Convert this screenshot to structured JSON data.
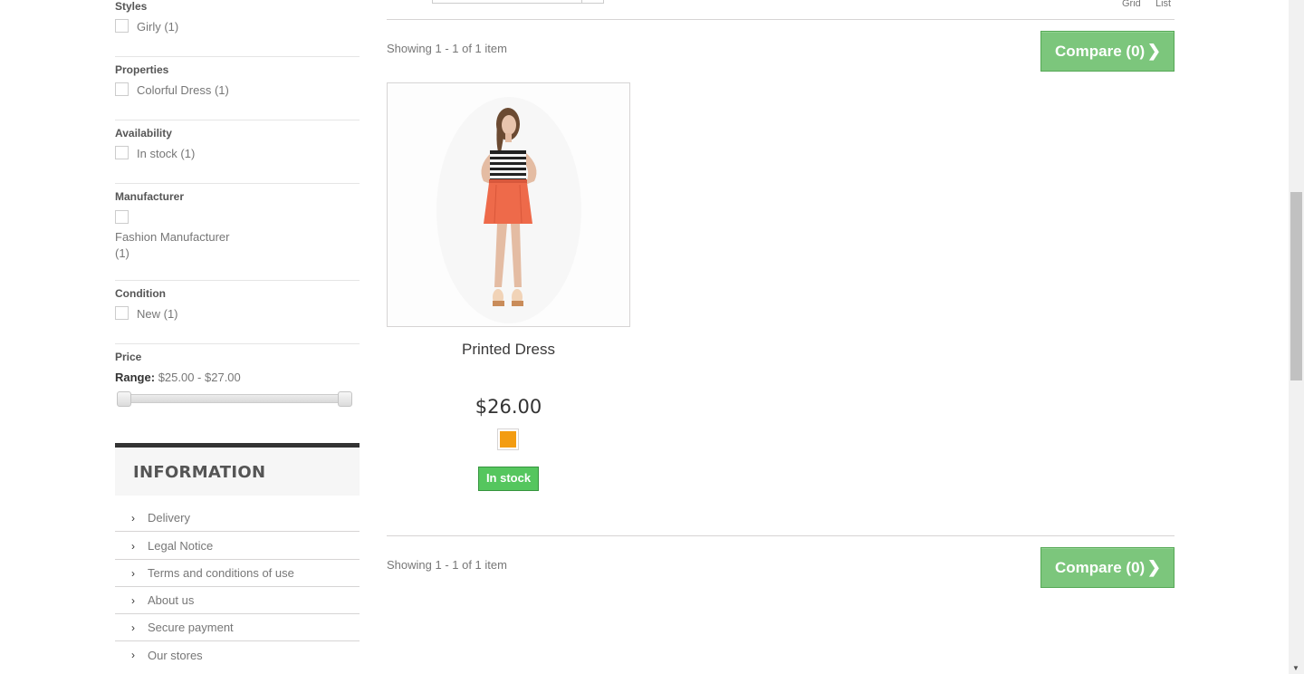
{
  "filters": {
    "styles": {
      "title": "Styles",
      "options": [
        "Girly (1)"
      ]
    },
    "properties": {
      "title": "Properties",
      "options": [
        "Colorful Dress (1)"
      ]
    },
    "availability": {
      "title": "Availability",
      "options": [
        "In stock (1)"
      ]
    },
    "manufacturer": {
      "title": "Manufacturer",
      "options": [
        "Fashion Manufacturer (1)"
      ]
    },
    "condition": {
      "title": "Condition",
      "options": [
        "New (1)"
      ]
    },
    "price": {
      "title": "Price",
      "range_label": "Range:",
      "range_value": "$25.00 - $27.00"
    }
  },
  "information": {
    "title": "INFORMATION",
    "items": [
      {
        "label": "Delivery"
      },
      {
        "label": "Legal Notice"
      },
      {
        "label": "Terms and conditions of use"
      },
      {
        "label": "About us"
      },
      {
        "label": "Secure payment"
      },
      {
        "label": "Our stores"
      }
    ]
  },
  "toolbar": {
    "view_grid": "Grid",
    "view_list": "List",
    "showing_top": "Showing 1 - 1 of 1 item",
    "showing_bottom": "Showing 1 - 1 of 1 item",
    "compare_label": "Compare (0)"
  },
  "product": {
    "name": "Printed Dress",
    "price": "$26.00",
    "availability": "In stock",
    "color_swatch": "#f39c11"
  },
  "colors": {
    "compare_bg": "#7cc67c",
    "stock_bg": "#55c65e",
    "info_border": "#333333"
  }
}
